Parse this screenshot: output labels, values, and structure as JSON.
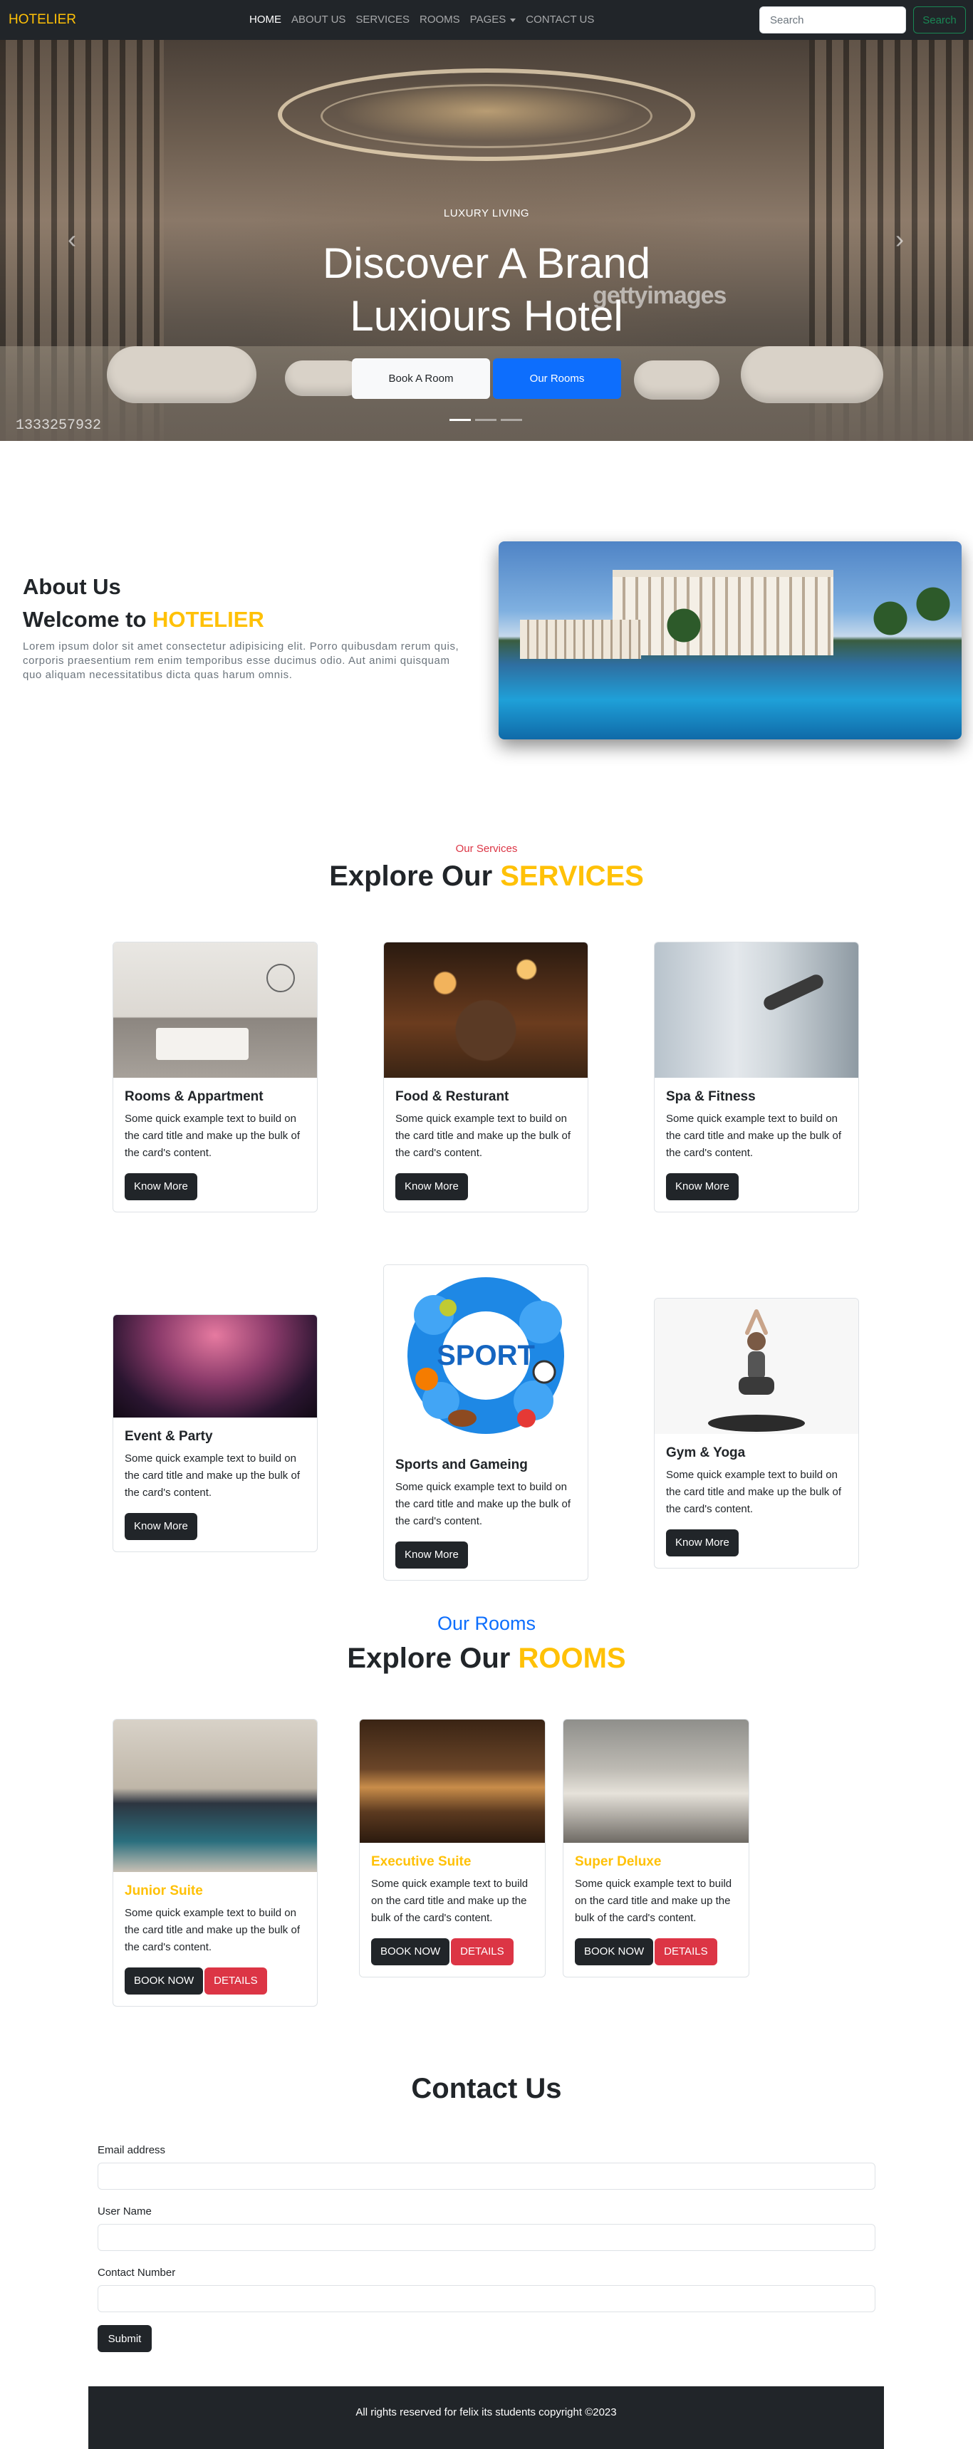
{
  "nav": {
    "brand": "HOTELIER",
    "links": [
      "HOME",
      "ABOUT US",
      "SERVICES",
      "ROOMS",
      "PAGES",
      "CONTACT US"
    ],
    "search_placeholder": "Search",
    "search_button": "Search"
  },
  "hero": {
    "subtitle": "LUXURY LIVING",
    "title": "Discover A Brand Luxiours Hotel",
    "btn_book": "Book A Room",
    "btn_rooms": "Our Rooms",
    "watermark": "gettyimages",
    "watermark_id": "1333257932",
    "indicators": 3,
    "active_indicator": 1
  },
  "about": {
    "heading": "About Us",
    "welcome_prefix": "Welcome to ",
    "welcome_brand": "HOTELIER",
    "text": "Lorem ipsum dolor sit amet consectetur adipisicing elit. Porro quibusdam rerum quis, corporis praesentium rem enim temporibus esse ducimus odio. Aut animi quisquam quo aliquam necessitatibus dicta quas harum omnis."
  },
  "services": {
    "label": "Our Services",
    "title_prefix": "Explore Our ",
    "title_accent": "SERVICES",
    "cards": [
      {
        "title": "Rooms & Appartment",
        "text": "Some quick example text to build on the card title and make up the bulk of the card's content.",
        "button": "Know More"
      },
      {
        "title": "Food & Resturant",
        "text": "Some quick example text to build on the card title and make up the bulk of the card's content.",
        "button": "Know More"
      },
      {
        "title": "Spa & Fitness",
        "text": "Some quick example text to build on the card title and make up the bulk of the card's content.",
        "button": "Know More"
      },
      {
        "title": "Event & Party",
        "text": "Some quick example text to build on the card title and make up the bulk of the card's content.",
        "button": "Know More"
      },
      {
        "title": "Sports and Gameing",
        "text": "Some quick example text to build on the card title and make up the bulk of the card's content.",
        "button": "Know More"
      },
      {
        "title": "Gym & Yoga",
        "text": "Some quick example text to build on the card title and make up the bulk of the card's content.",
        "button": "Know More"
      }
    ],
    "sport_logo_text": "SPORT"
  },
  "rooms": {
    "label": "Our Rooms",
    "title_prefix": "Explore Our ",
    "title_accent": "ROOMS",
    "cards": [
      {
        "title": "Junior Suite",
        "text": "Some quick example text to build on the card title and make up the bulk of the card's content.",
        "book": "BOOK NOW",
        "details": "DETAILS"
      },
      {
        "title": "Executive Suite",
        "text": "Some quick example text to build on the card title and make up the bulk of the card's content.",
        "book": "BOOK NOW",
        "details": "DETAILS"
      },
      {
        "title": "Super Deluxe",
        "text": "Some quick example text to build on the card title and make up the bulk of the card's content.",
        "book": "BOOK NOW",
        "details": "DETAILS"
      }
    ]
  },
  "contact": {
    "title": "Contact Us",
    "email_label": "Email address",
    "name_label": "User Name",
    "phone_label": "Contact Number",
    "submit": "Submit"
  },
  "footer": {
    "text": "All rights reserved for felix its students copyright ©2023"
  },
  "colors": {
    "accent": "#ffc107",
    "primary": "#0d6efd",
    "danger": "#dc3545",
    "dark": "#212529",
    "success": "#198754"
  },
  "icons": {
    "carousel_prev": "chevron-left-icon",
    "carousel_next": "chevron-right-icon",
    "dropdown": "caret-down-icon"
  }
}
